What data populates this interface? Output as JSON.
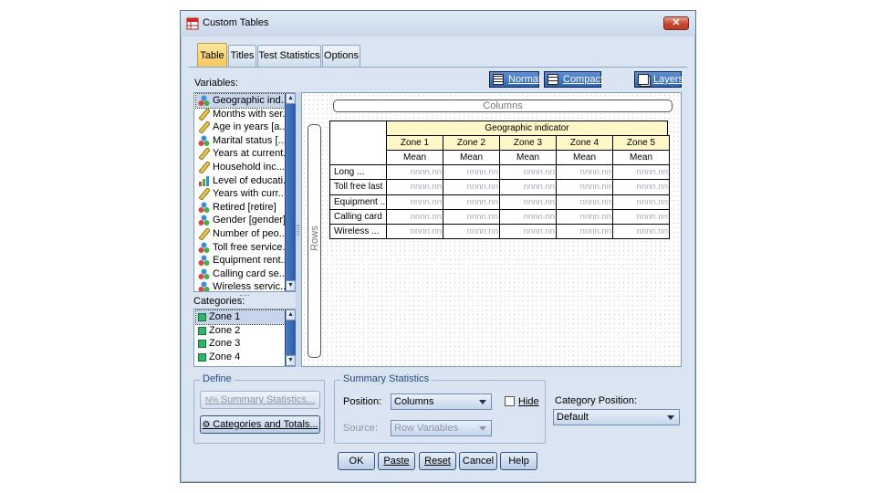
{
  "window": {
    "title": "Custom Tables",
    "close_glyph": "✕"
  },
  "tabs": [
    {
      "label": "Table",
      "active": true
    },
    {
      "label": "Titles",
      "active": false
    },
    {
      "label": "Test Statistics",
      "active": false
    },
    {
      "label": "Options",
      "active": false
    }
  ],
  "toolbar": {
    "normal_label": "Normal",
    "compact_label": "Compact",
    "layers_label": "Layers"
  },
  "variables": {
    "label": "Variables:",
    "items": [
      {
        "label": "Geographic ind...",
        "icon": "nominal-icon",
        "selected": true
      },
      {
        "label": "Months with ser...",
        "icon": "scale-icon"
      },
      {
        "label": "Age in years [a...",
        "icon": "scale-icon"
      },
      {
        "label": "Marital status [...",
        "icon": "nominal-icon"
      },
      {
        "label": "Years at current...",
        "icon": "scale-icon"
      },
      {
        "label": "Household inc...",
        "icon": "scale-icon"
      },
      {
        "label": "Level of educati...",
        "icon": "ordinal-icon"
      },
      {
        "label": "Years with curr...",
        "icon": "scale-icon"
      },
      {
        "label": "Retired [retire]",
        "icon": "nominal-icon"
      },
      {
        "label": "Gender [gender]",
        "icon": "nominal-icon"
      },
      {
        "label": "Number of peo...",
        "icon": "scale-icon"
      },
      {
        "label": "Toll free service...",
        "icon": "nominal-icon"
      },
      {
        "label": "Equipment rent...",
        "icon": "nominal-icon"
      },
      {
        "label": "Calling card se...",
        "icon": "nominal-icon"
      },
      {
        "label": "Wireless servic...",
        "icon": "nominal-icon"
      }
    ]
  },
  "categories": {
    "label": "Categories:",
    "items": [
      {
        "label": "Zone 1",
        "selected": true
      },
      {
        "label": "Zone 2"
      },
      {
        "label": "Zone 3"
      },
      {
        "label": "Zone 4"
      }
    ]
  },
  "canvas": {
    "columns_label": "Columns",
    "rows_label": "Rows",
    "column_variable": "Geographic indicator",
    "zones": [
      "Zone 1",
      "Zone 2",
      "Zone 3",
      "Zone 4",
      "Zone 5"
    ],
    "stat_label": "Mean",
    "row_labels": [
      "Long ...",
      "Toll free last ...",
      "Equipment ...",
      "Calling card",
      "Wireless ..."
    ],
    "cell_placeholder": "nnnn.nn"
  },
  "define": {
    "title": "Define",
    "summary_statistics_label": "Summary Statistics...",
    "summary_statistics_enabled": false,
    "categories_totals_label": "Categories and Totals..."
  },
  "summary": {
    "title": "Summary Statistics",
    "position_label": "Position:",
    "position_value": "Columns",
    "hide_label": "Hide",
    "hide_checked": false,
    "source_label": "Source:",
    "source_value": "Row Variables",
    "source_enabled": false
  },
  "category_position": {
    "label": "Category Position:",
    "value": "Default"
  },
  "buttons": {
    "ok": "OK",
    "paste": "Paste",
    "reset": "Reset",
    "cancel": "Cancel",
    "help": "Help"
  },
  "colors": {
    "accent_tab": "#f5c85a",
    "toolbar_button": "#2e66b4",
    "header_fill": "#fff7c8",
    "category_swatch": "#2fb46a"
  }
}
